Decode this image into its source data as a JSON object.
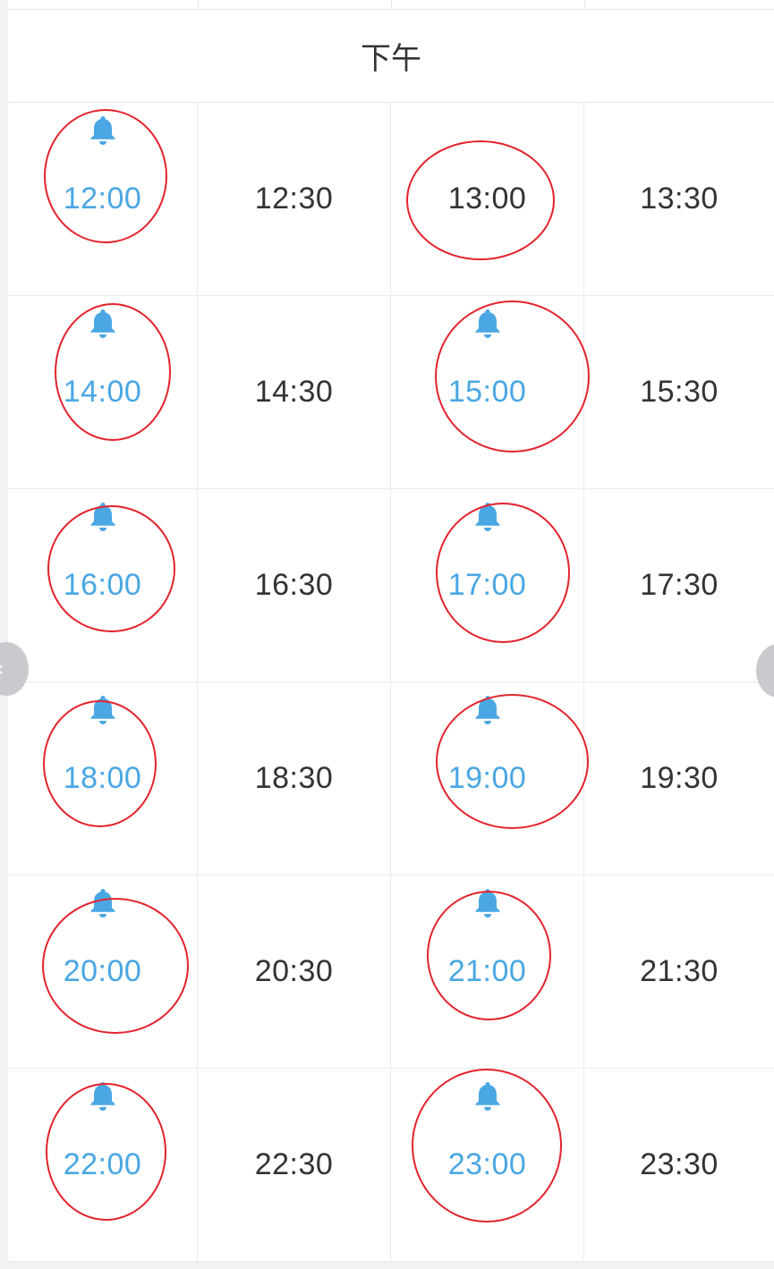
{
  "section": {
    "title": "下午"
  },
  "colors": {
    "reminder_time": "#4aa7e3",
    "default_time": "#333333",
    "bell": "#4aa7e3",
    "annotation_circle": "#e3232c",
    "grid_line": "#e9ebee"
  },
  "slots": [
    {
      "time": "12:00",
      "reminder": true,
      "circled": true
    },
    {
      "time": "12:30",
      "reminder": false,
      "circled": false
    },
    {
      "time": "13:00",
      "reminder": false,
      "circled": true
    },
    {
      "time": "13:30",
      "reminder": false,
      "circled": false
    },
    {
      "time": "14:00",
      "reminder": true,
      "circled": true
    },
    {
      "time": "14:30",
      "reminder": false,
      "circled": false
    },
    {
      "time": "15:00",
      "reminder": true,
      "circled": true
    },
    {
      "time": "15:30",
      "reminder": false,
      "circled": false
    },
    {
      "time": "16:00",
      "reminder": true,
      "circled": true
    },
    {
      "time": "16:30",
      "reminder": false,
      "circled": false
    },
    {
      "time": "17:00",
      "reminder": true,
      "circled": true
    },
    {
      "time": "17:30",
      "reminder": false,
      "circled": false
    },
    {
      "time": "18:00",
      "reminder": true,
      "circled": true
    },
    {
      "time": "18:30",
      "reminder": false,
      "circled": false
    },
    {
      "time": "19:00",
      "reminder": true,
      "circled": true
    },
    {
      "time": "19:30",
      "reminder": false,
      "circled": false
    },
    {
      "time": "20:00",
      "reminder": true,
      "circled": true
    },
    {
      "time": "20:30",
      "reminder": false,
      "circled": false
    },
    {
      "time": "21:00",
      "reminder": true,
      "circled": true
    },
    {
      "time": "21:30",
      "reminder": false,
      "circled": false
    },
    {
      "time": "22:00",
      "reminder": true,
      "circled": true
    },
    {
      "time": "22:30",
      "reminder": false,
      "circled": false
    },
    {
      "time": "23:00",
      "reminder": true,
      "circled": true
    },
    {
      "time": "23:30",
      "reminder": false,
      "circled": false
    }
  ],
  "icons": {
    "reminder": "bell-icon",
    "prev": "chevron-left-icon",
    "next": "chevron-right-icon"
  }
}
